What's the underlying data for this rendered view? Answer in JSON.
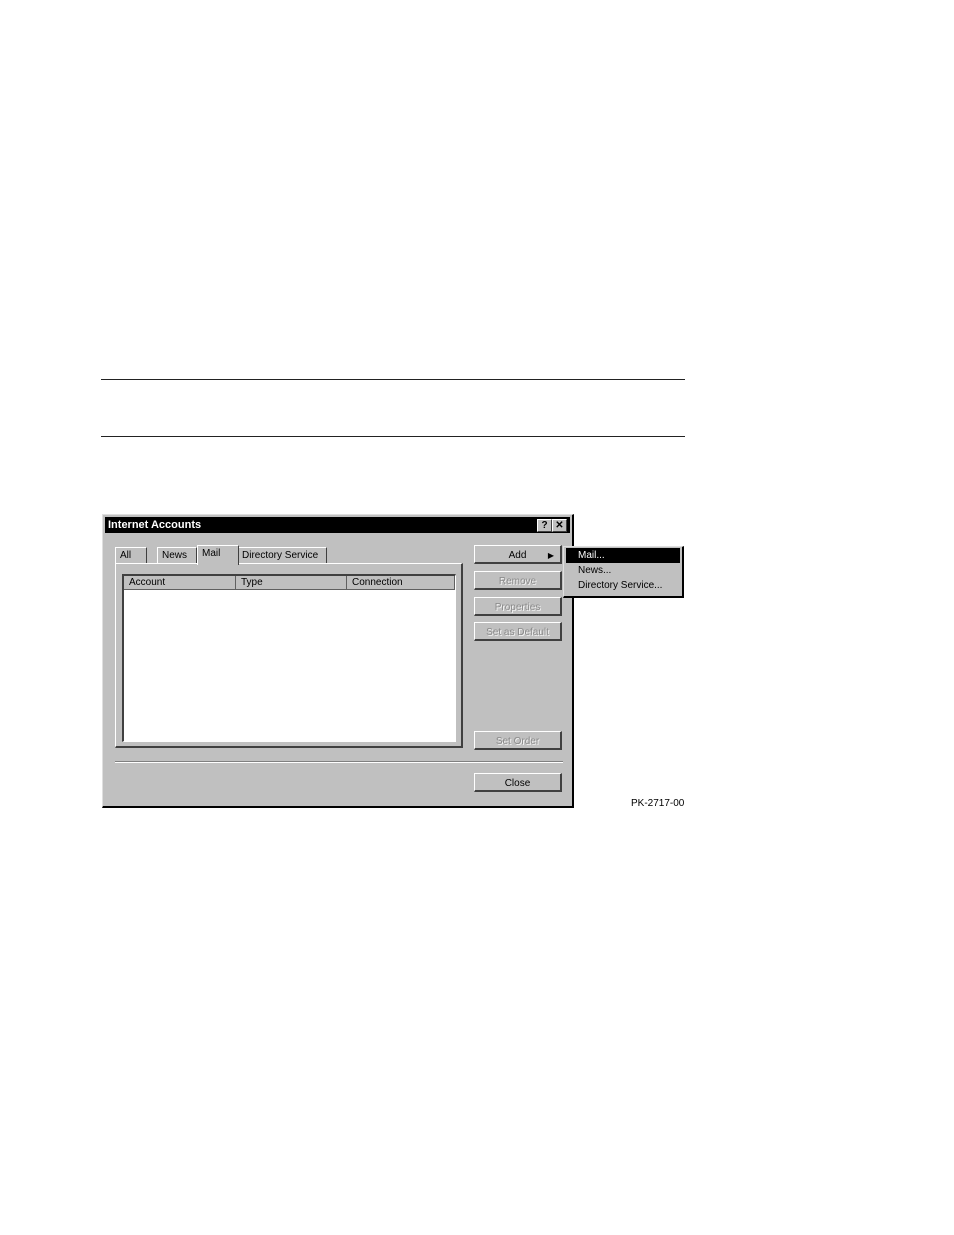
{
  "dialog": {
    "title": "Internet Accounts",
    "help_glyph": "?",
    "close_glyph": "✕"
  },
  "tabs": [
    {
      "label": "All"
    },
    {
      "label": "News"
    },
    {
      "label": "Mail"
    },
    {
      "label": "Directory Service"
    }
  ],
  "active_tab": "Mail",
  "list": {
    "columns": [
      "Account",
      "Type",
      "Connection"
    ],
    "rows": []
  },
  "buttons": {
    "add": "Add",
    "add_arrow": "▶",
    "remove": "Remove",
    "properties": "Properties",
    "set_as_default": "Set as Default",
    "set_order": "Set Order",
    "close": "Close"
  },
  "add_menu": {
    "items": [
      "Mail...",
      "News...",
      "Directory Service..."
    ],
    "selected": "Mail..."
  },
  "figure_label": "PK-2717-00"
}
